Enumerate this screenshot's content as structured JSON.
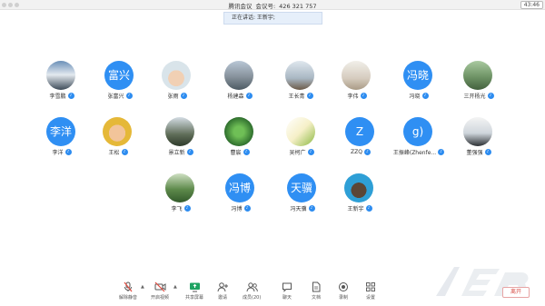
{
  "window": {
    "app_name": "腾讯会议",
    "meeting_label": "会议号:",
    "meeting_id": "426 321 757",
    "time": "43:46"
  },
  "banner": {
    "text": "正在讲话: 王新宇;"
  },
  "participants": [
    {
      "name": "李雪鹏",
      "avatar_text": ""
    },
    {
      "name": "张富兴",
      "avatar_text": "富兴"
    },
    {
      "name": "张雨",
      "avatar_text": ""
    },
    {
      "name": "杨建森",
      "avatar_text": ""
    },
    {
      "name": "王长青",
      "avatar_text": ""
    },
    {
      "name": "李伟",
      "avatar_text": ""
    },
    {
      "name": "冯晓",
      "avatar_text": "冯晓"
    },
    {
      "name": "三开杨光",
      "avatar_text": ""
    },
    {
      "name": "李洋",
      "avatar_text": "李洋"
    },
    {
      "name": "王松",
      "avatar_text": ""
    },
    {
      "name": "景立新",
      "avatar_text": ""
    },
    {
      "name": "曹宸",
      "avatar_text": ""
    },
    {
      "name": "吴柯广",
      "avatar_text": ""
    },
    {
      "name": "ZZQ",
      "avatar_text": "Z"
    },
    {
      "name": "王振峰(Zhenfe...",
      "avatar_text": "g)"
    },
    {
      "name": "董强强",
      "avatar_text": ""
    },
    {
      "name": "李飞",
      "avatar_text": ""
    },
    {
      "name": "冯博",
      "avatar_text": "冯博"
    },
    {
      "name": "冯天骥",
      "avatar_text": "天骥"
    },
    {
      "name": "王新宇",
      "avatar_text": ""
    }
  ],
  "toolbar": {
    "unmute": "解除静音",
    "video": "开启视频",
    "share": "共享屏幕",
    "invite": "邀请",
    "members": "成员(20)",
    "chat": "聊天",
    "docs": "文档",
    "record": "录制",
    "settings": "设置",
    "end": "离开"
  },
  "colors": {
    "accent": "#2f8ff3",
    "end": "#d8514a",
    "banner": "#e6effa"
  }
}
